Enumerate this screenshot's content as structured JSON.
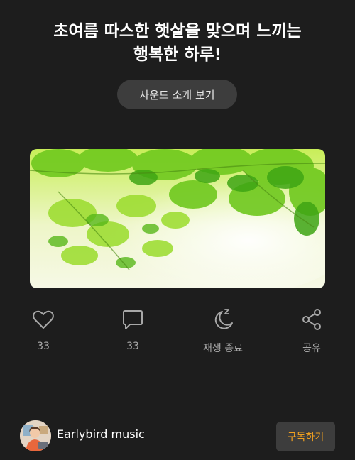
{
  "header": {
    "title_line1": "초여름 따스한 햇살을 맞으며 느끼는",
    "title_line2": "행복한 하루!",
    "sound_button_label": "사운드 소개 보기"
  },
  "actions": {
    "like": {
      "icon": "heart-icon",
      "label": "33"
    },
    "comment": {
      "icon": "speech-bubble-icon",
      "label": "33"
    },
    "sleep_timer": {
      "icon": "moon-sleep-icon",
      "label": "재생 종료"
    },
    "share": {
      "icon": "share-icon",
      "label": "공유"
    }
  },
  "channel": {
    "name": "Earlybird music",
    "subscribe_label": "구독하기"
  },
  "colors": {
    "background": "#1d1d1d",
    "button_bg": "#3d3d3d",
    "accent": "#f0a020",
    "muted_text": "#a8a8a8"
  }
}
